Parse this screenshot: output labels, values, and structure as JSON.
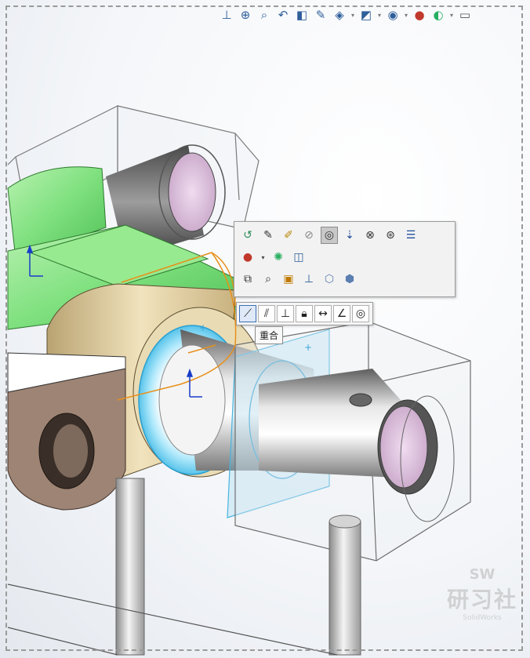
{
  "heads_up_toolbar": {
    "icons": [
      "normal-to-icon",
      "zoom-to-fit-icon",
      "zoom-to-area-icon",
      "previous-view-icon",
      "section-view-icon",
      "dynamic-annotation-icon",
      "view-orientation-icon",
      "display-style-icon",
      "hide-show-items-icon",
      "edit-appearance-icon",
      "apply-scene-icon",
      "view-settings-icon",
      "monitor-icon"
    ]
  },
  "context_toolbar": {
    "row1": [
      "edit-feature-icon",
      "edit-sketch-icon",
      "edit-part-icon",
      "hide-components-icon",
      "change-transparency-icon",
      "isolate-icon",
      "mate-icon",
      "component-display-icon",
      "properties-icon"
    ],
    "row2": [
      "appearance-icon",
      "appearance-dropdown-icon",
      "appearance-callout-icon",
      "material-icon"
    ],
    "row3": [
      "zoom-to-selection-icon",
      "zoom-icon",
      "select-other-icon",
      "normal-to-icon",
      "view-face-icon",
      "view-part-icon"
    ],
    "active_icon": "change-transparency-icon"
  },
  "relations_toolbar": {
    "icons": [
      "coincident-icon",
      "parallel-icon",
      "perpendicular-icon",
      "lock-icon",
      "distance-icon",
      "angle-icon",
      "concentric-icon"
    ],
    "active_icon": "coincident-icon",
    "tooltip": "重合"
  },
  "watermark": {
    "line1": "SW",
    "line2": "研习社",
    "line3": "SolidWorks"
  },
  "colors": {
    "green_part": "#7ee07e",
    "tan_part": "#d8c598",
    "mauve_part": "#9e8474",
    "selection_cyan": "#7fd6f0",
    "bore_pink": "#e4c8e4",
    "transparent_block_edge": "#6f6f6f",
    "sketch_orange": "#e7901b"
  }
}
